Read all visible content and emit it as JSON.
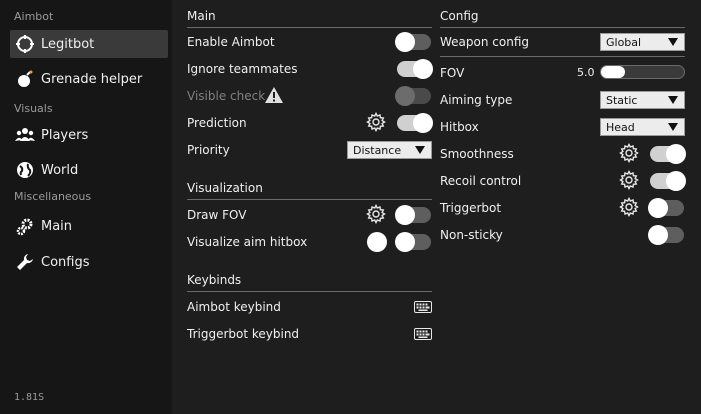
{
  "sidebar": {
    "sections": [
      "Aimbot",
      "Visuals",
      "Miscellaneous"
    ],
    "items": [
      {
        "label": "Legitbot",
        "icon": "crosshair-icon",
        "active": true
      },
      {
        "label": "Grenade helper",
        "icon": "bomb-icon",
        "active": false
      },
      {
        "label": "Players",
        "icon": "users-icon",
        "active": false
      },
      {
        "label": "World",
        "icon": "globe-icon",
        "active": false
      },
      {
        "label": "Main",
        "icon": "gears-icon",
        "active": false
      },
      {
        "label": "Configs",
        "icon": "wrench-icon",
        "active": false
      }
    ],
    "version": "1.81S"
  },
  "main": {
    "title": "Main",
    "enable_aimbot": {
      "label": "Enable Aimbot",
      "on": false
    },
    "ignore_teammates": {
      "label": "Ignore teammates",
      "on": true
    },
    "visible_check": {
      "label": "Visible check",
      "on": false,
      "disabled": true,
      "icon": "warning-icon"
    },
    "prediction": {
      "label": "Prediction",
      "on": true
    },
    "priority": {
      "label": "Priority",
      "value": "Distance"
    }
  },
  "visualization": {
    "title": "Visualization",
    "draw_fov": {
      "label": "Draw FOV",
      "on": false
    },
    "visualize_aim_hitbox": {
      "label": "Visualize aim hitbox",
      "on": false,
      "color": "#ffffff"
    }
  },
  "keybinds": {
    "title": "Keybinds",
    "aimbot_keybind": {
      "label": "Aimbot keybind",
      "icon": "keyboard-icon"
    },
    "triggerbot_keybind": {
      "label": "Triggerbot keybind",
      "icon": "keyboard-icon"
    }
  },
  "config": {
    "title": "Config",
    "weapon_config": {
      "label": "Weapon config",
      "value": "Global"
    },
    "fov": {
      "label": "FOV",
      "value_text": "5.0",
      "fraction": 0.05
    },
    "aiming_type": {
      "label": "Aiming type",
      "value": "Static"
    },
    "hitbox": {
      "label": "Hitbox",
      "value": "Head"
    },
    "smoothness": {
      "label": "Smoothness",
      "on": true
    },
    "recoil_control": {
      "label": "Recoil control",
      "on": true
    },
    "triggerbot": {
      "label": "Triggerbot",
      "on": false
    },
    "non_sticky": {
      "label": "Non-sticky",
      "on": false
    }
  },
  "colors": {
    "accent": "#ffffff",
    "toggle_off_track": "#5e5e5e",
    "toggle_on_track": "#d0d0d0"
  }
}
